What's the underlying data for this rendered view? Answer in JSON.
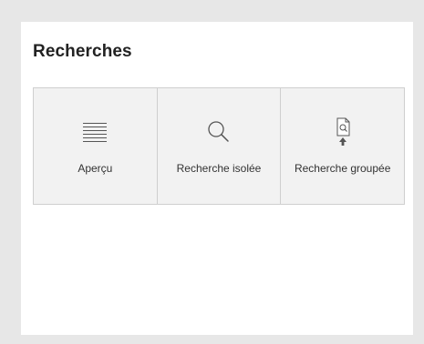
{
  "panel": {
    "title": "Recherches"
  },
  "tiles": [
    {
      "label": "Aperçu",
      "icon": "list-lines-icon"
    },
    {
      "label": "Recherche isolée",
      "icon": "search-icon"
    },
    {
      "label": "Recherche groupée",
      "icon": "document-search-upload-icon"
    }
  ],
  "colors": {
    "page_background": "#e7e7e7",
    "panel_background": "#ffffff",
    "tile_background": "#f2f2f2",
    "tile_border": "#cfcfcf",
    "icon": "#555555",
    "text": "#333333"
  }
}
